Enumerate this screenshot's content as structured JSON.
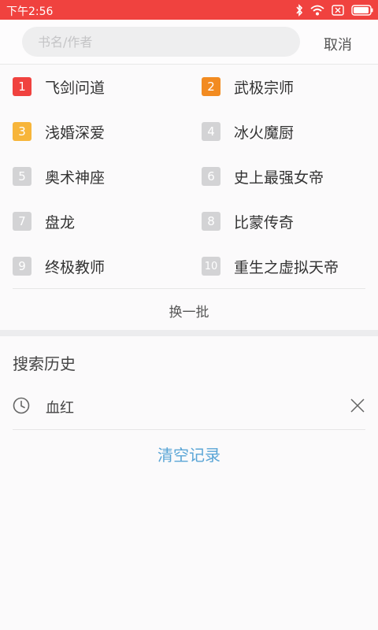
{
  "status_bar": {
    "time": "下午2:56",
    "background": "#f0423f",
    "icons": [
      "bluetooth-icon",
      "wifi-icon",
      "sim-icon",
      "battery-icon"
    ]
  },
  "search": {
    "placeholder": "书名/作者",
    "value": "",
    "cancel_label": "取消"
  },
  "hot_list": {
    "rank_colors": {
      "1": "#f0423f",
      "2": "#f28b21",
      "3": "#f7b53a",
      "default": "#d3d3d5"
    },
    "items": [
      {
        "rank": "1",
        "title": "飞剑问道"
      },
      {
        "rank": "2",
        "title": "武极宗师"
      },
      {
        "rank": "3",
        "title": "浅婚深爱"
      },
      {
        "rank": "4",
        "title": "冰火魔厨"
      },
      {
        "rank": "5",
        "title": "奥术神座"
      },
      {
        "rank": "6",
        "title": "史上最强女帝"
      },
      {
        "rank": "7",
        "title": "盘龙"
      },
      {
        "rank": "8",
        "title": "比蒙传奇"
      },
      {
        "rank": "9",
        "title": "终极教师"
      },
      {
        "rank": "10",
        "title": "重生之虚拟天帝"
      }
    ],
    "refresh_label": "换一批"
  },
  "history": {
    "title": "搜索历史",
    "items": [
      {
        "icon": "clock-icon",
        "text": "血红",
        "remove_icon": "close-icon"
      }
    ],
    "clear_label": "清空记录",
    "clear_color": "#5aa5d6"
  }
}
